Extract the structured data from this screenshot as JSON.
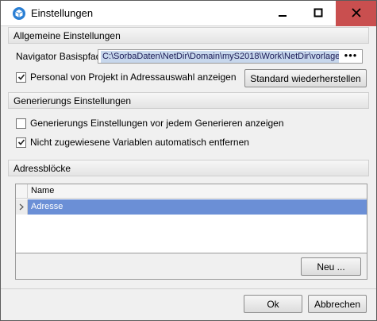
{
  "window": {
    "title": "Einstellungen",
    "icon": "cube-icon",
    "controls": [
      "minimize-icon",
      "maximize-icon",
      "close-icon"
    ],
    "close_color": "#c94f4f"
  },
  "general": {
    "header": "Allgemeine Einstellungen",
    "navigator_label": "Navigator Basispfad",
    "navigator_path": "C:\\SorbaDaten\\NetDir\\Domain\\myS2018\\Work\\NetDir\\vorlagen\\S",
    "browse_label": "•••",
    "checkbox_personal_label": "Personal von Projekt in Adressauswahl anzeigen",
    "checkbox_personal_checked": true,
    "restore_button": "Standard wiederherstellen"
  },
  "generation": {
    "header": "Generierungs Einstellungen",
    "checkbox_show_label": "Generierungs Einstellungen vor jedem Generieren anzeigen",
    "checkbox_show_checked": false,
    "checkbox_remove_label": "Nicht zugewiesene Variablen automatisch entfernen",
    "checkbox_remove_checked": true
  },
  "address_blocks": {
    "header": "Adressblöcke",
    "column_name": "Name",
    "rows": [
      "Adresse"
    ],
    "selected_row": 0,
    "selection_color": "#6b8fd6",
    "new_button": "Neu ..."
  },
  "footer": {
    "ok_button": "Ok",
    "cancel_button": "Abbrechen"
  }
}
